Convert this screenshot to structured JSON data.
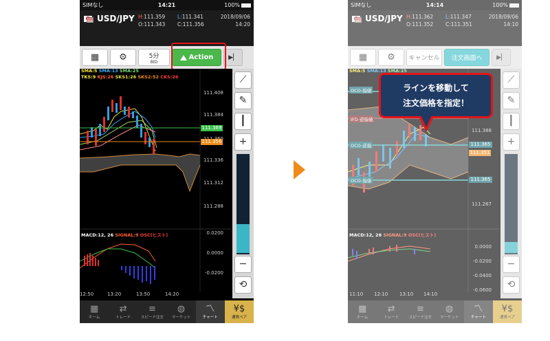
{
  "left_phone": {
    "status": {
      "carrier": "SIMなし",
      "time": "14:21",
      "battery": "100%"
    },
    "header": {
      "pair": "USD/JPY",
      "high_label": "H:",
      "high": "111.359",
      "open_label": "O:",
      "open": "111.343",
      "low_label": "L:",
      "low": "111.341",
      "close_label": "C:",
      "close": "111.356",
      "date": "2018/09/06",
      "time": "14:20"
    },
    "toolbar": {
      "interval": "5分",
      "price_type": "BID",
      "action_label": "Action"
    },
    "indicators_top": [
      "SMA:5",
      "SMA:13",
      "SMA:25"
    ],
    "indicators_ichimoku": [
      "TKS:9",
      "KJS:26",
      "SKS1:26",
      "SKS2:52",
      "CKS:26"
    ],
    "price_labels": [
      "111.408",
      "111.384",
      "111.360",
      "111.336",
      "111.312",
      "111.288"
    ],
    "price_tags": [
      "111.369",
      "111.356"
    ],
    "macd_labels": [
      "MACD:12, 26",
      "SIGNAL:9",
      "OSC(ヒスト)",
      "0.0200"
    ],
    "macd_values": [
      "0.0200",
      "0.0000",
      "-0.0200"
    ],
    "x_labels": [
      "12:50",
      "13:20",
      "13:50",
      "14:20"
    ]
  },
  "right_phone": {
    "status": {
      "carrier": "SIMなし",
      "time": "14:14",
      "battery": "100%"
    },
    "header": {
      "pair": "USD/JPY",
      "high_label": "H:",
      "high": "111.362",
      "open_label": "O:",
      "open": "111.352",
      "low_label": "L:",
      "low": "111.347",
      "close_label": "C:",
      "close": "111.351",
      "date": "2018/09/06",
      "time": "14:10"
    },
    "toolbar": {
      "cancel_label": "キャンセル",
      "order_screen_label": "注文画面へ"
    },
    "indicators_top": [
      "SMA:5",
      "SMA:13",
      "SMA:25"
    ],
    "oco_labels": [
      "OCO-指値",
      "IFD-逆指値",
      "OCO-逆指",
      "OCO-指値"
    ],
    "price_labels": [
      "111.388",
      "111.267"
    ],
    "price_tags": [
      "111.365",
      "111.351",
      "111.365"
    ],
    "macd_labels": [
      "MACD:12, 26",
      "SIGNAL:9",
      "OSC(ヒスト)"
    ],
    "macd_values": [
      "0.0000",
      "-0.0200",
      "-0.0400",
      "-0.0600"
    ],
    "x_labels": [
      "11:10",
      "12:10",
      "13:10",
      "14:10"
    ]
  },
  "tabs": [
    {
      "label": "ホーム",
      "icon": "grid-icon"
    },
    {
      "label": "トレード",
      "icon": "exchange-icon"
    },
    {
      "label": "スピード注文",
      "icon": "speed-icon"
    },
    {
      "label": "マーケット",
      "icon": "globe-icon"
    },
    {
      "label": "チャート",
      "icon": "chart-icon"
    },
    {
      "label": "通貨ペア",
      "icon": "currency-pair-icon"
    }
  ],
  "callout": {
    "line1": "ラインを移動して",
    "line2": "注文価格を指定！"
  },
  "colors": {
    "action_green": "#4ab84a",
    "highlight_red": "#e3141a",
    "arrow_orange": "#f08a19",
    "teal": "#3bb6c6",
    "callout_navy": "#1f3a63"
  }
}
